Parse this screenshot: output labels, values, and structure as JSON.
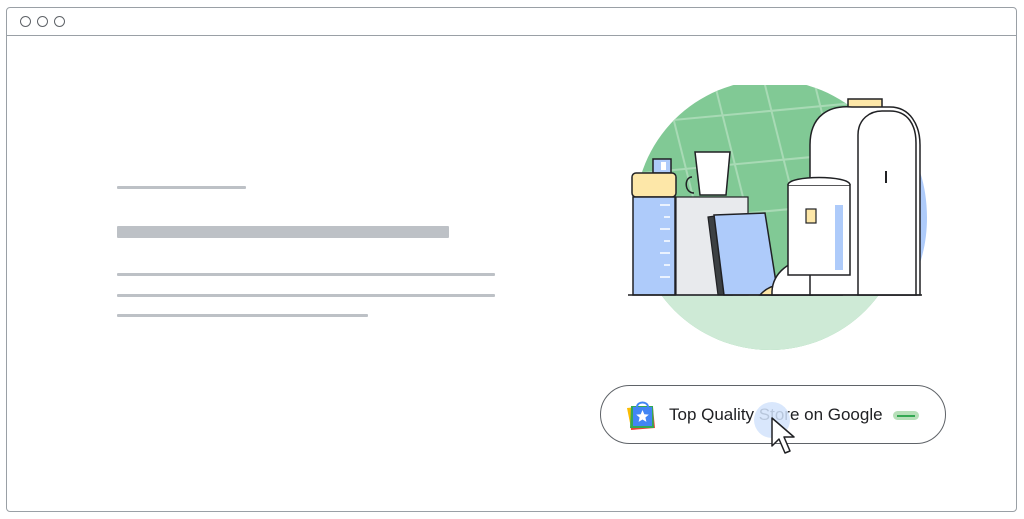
{
  "window": {
    "controls": [
      "window-dot",
      "window-dot",
      "window-dot"
    ]
  },
  "placeholder_text": {
    "lines": [
      "eyebrow",
      "heading",
      "body-line",
      "body-line",
      "body-line"
    ]
  },
  "illustration": {
    "subject": "travel gear: water bottle, mug, notebooks, cap, backpack",
    "colors": {
      "circle_green": "#81c995",
      "ground_green": "#ceead6",
      "blue_fill": "#aecbfa",
      "outline": "#202124"
    }
  },
  "badge": {
    "icon": "shopping-bag-star-icon",
    "label": "Top Quality Store on Google",
    "accent_color": "#34a853"
  },
  "cursor": {
    "icon": "pointer-cursor-icon"
  }
}
